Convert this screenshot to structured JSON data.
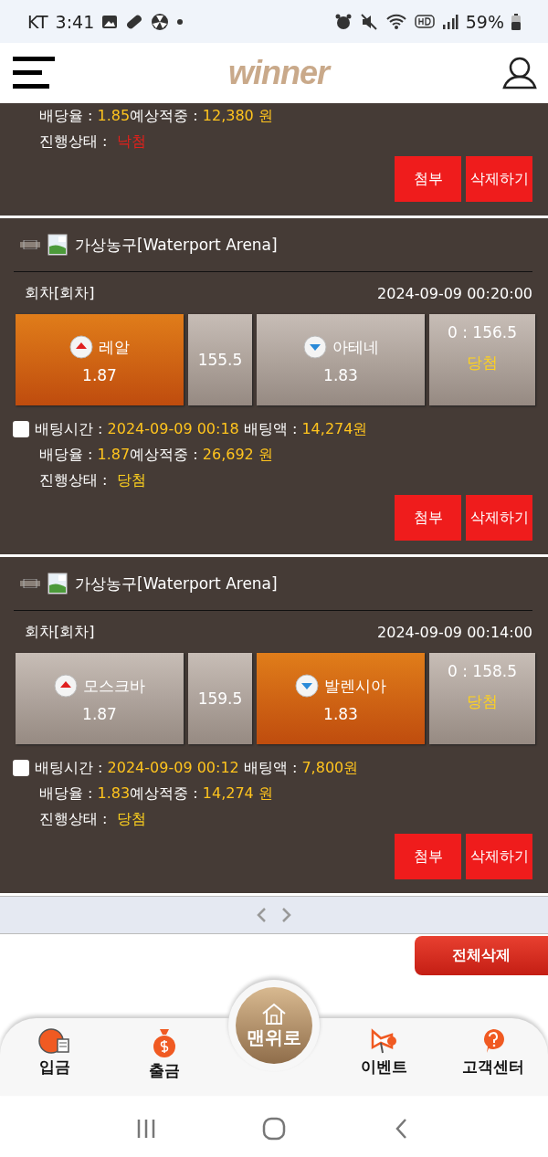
{
  "status_bar": {
    "carrier": "KT",
    "time": "3:41",
    "battery": "59%"
  },
  "header": {
    "logo": "winner"
  },
  "partial_bet": {
    "odds_label": "배당율 :",
    "odds": "1.85",
    "expected_label": "예상적중 :",
    "expected": "12,380 원",
    "status_label": "진행상태 :",
    "status": "낙첨",
    "kind": "lost",
    "buttons": [
      "첨부",
      "삭제하기"
    ]
  },
  "bets": [
    {
      "game": "가상농구[Waterport Arena]",
      "round": "회차[회차]",
      "datetime": "2024-09-09 00:20:00",
      "options": [
        {
          "team": "레알",
          "odds": "1.87",
          "selected": true,
          "kind": "up"
        },
        {
          "team": "아테네",
          "odds": "1.83",
          "selected": false,
          "kind": "down"
        }
      ],
      "handicap": "155.5",
      "score": "0 : 156.5",
      "score_status": "당첨",
      "checked": false,
      "bet_time_label": "배팅시간 :",
      "bet_time": "2024-09-09 00:18",
      "amount_label": "배팅액 :",
      "amount": "14,274원",
      "odds_label": "배당율 :",
      "odds": "1.87",
      "expected_label": "예상적중 :",
      "expected": "26,692 원",
      "status_label": "진행상태 :",
      "status": "당첨",
      "kind": "won",
      "buttons": [
        "첨부",
        "삭제하기"
      ]
    },
    {
      "game": "가상농구[Waterport Arena]",
      "round": "회차[회차]",
      "datetime": "2024-09-09 00:14:00",
      "options": [
        {
          "team": "모스크바",
          "odds": "1.87",
          "selected": false,
          "kind": "up"
        },
        {
          "team": "발렌시아",
          "odds": "1.83",
          "selected": true,
          "kind": "down"
        }
      ],
      "handicap": "159.5",
      "score": "0 : 158.5",
      "score_status": "당첨",
      "checked": false,
      "bet_time_label": "배팅시간 :",
      "bet_time": "2024-09-09 00:12",
      "amount_label": "배팅액 :",
      "amount": "7,800원",
      "odds_label": "배당율 :",
      "odds": "1.83",
      "expected_label": "예상적중 :",
      "expected": "14,274 원",
      "status_label": "진행상태 :",
      "status": "당첨",
      "kind": "won",
      "buttons": [
        "첨부",
        "삭제하기"
      ]
    }
  ],
  "delete_all": "전체삭제",
  "bottom_nav": [
    {
      "label": "입금",
      "kind": "item"
    },
    {
      "label": "출금",
      "kind": "item"
    },
    {
      "label": "맨위로",
      "kind": "center"
    },
    {
      "label": "이벤트",
      "kind": "item"
    },
    {
      "label": "고객센터",
      "kind": "item"
    }
  ]
}
